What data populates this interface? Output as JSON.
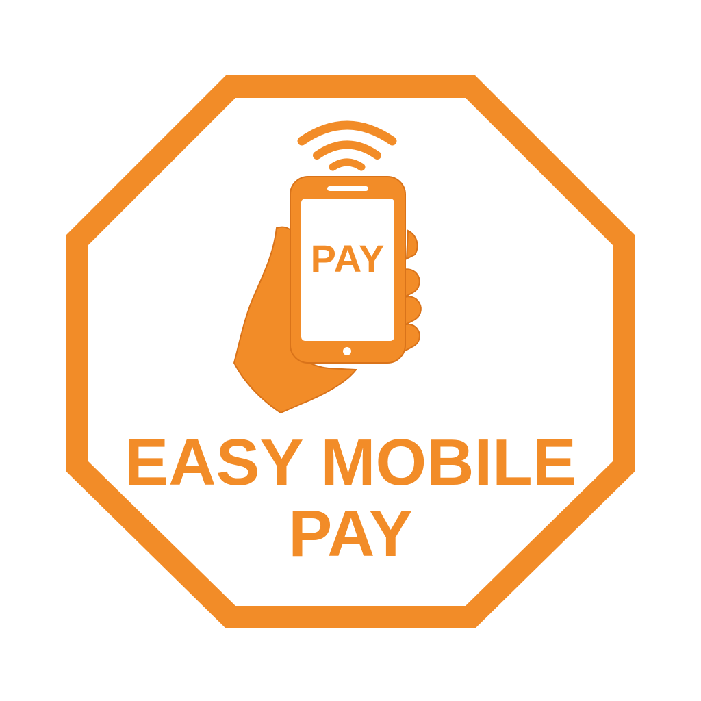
{
  "colors": {
    "accent": "#F28C28",
    "accent_dark": "#D9731A",
    "background": "#FFFFFF"
  },
  "icons": {
    "hand": "hand-icon",
    "phone": "smartphone-icon",
    "signal": "wireless-signal-icon"
  },
  "phone_screen_text": "PAY",
  "headline": {
    "line1": "EASY MOBILE",
    "line2": "PAY"
  }
}
